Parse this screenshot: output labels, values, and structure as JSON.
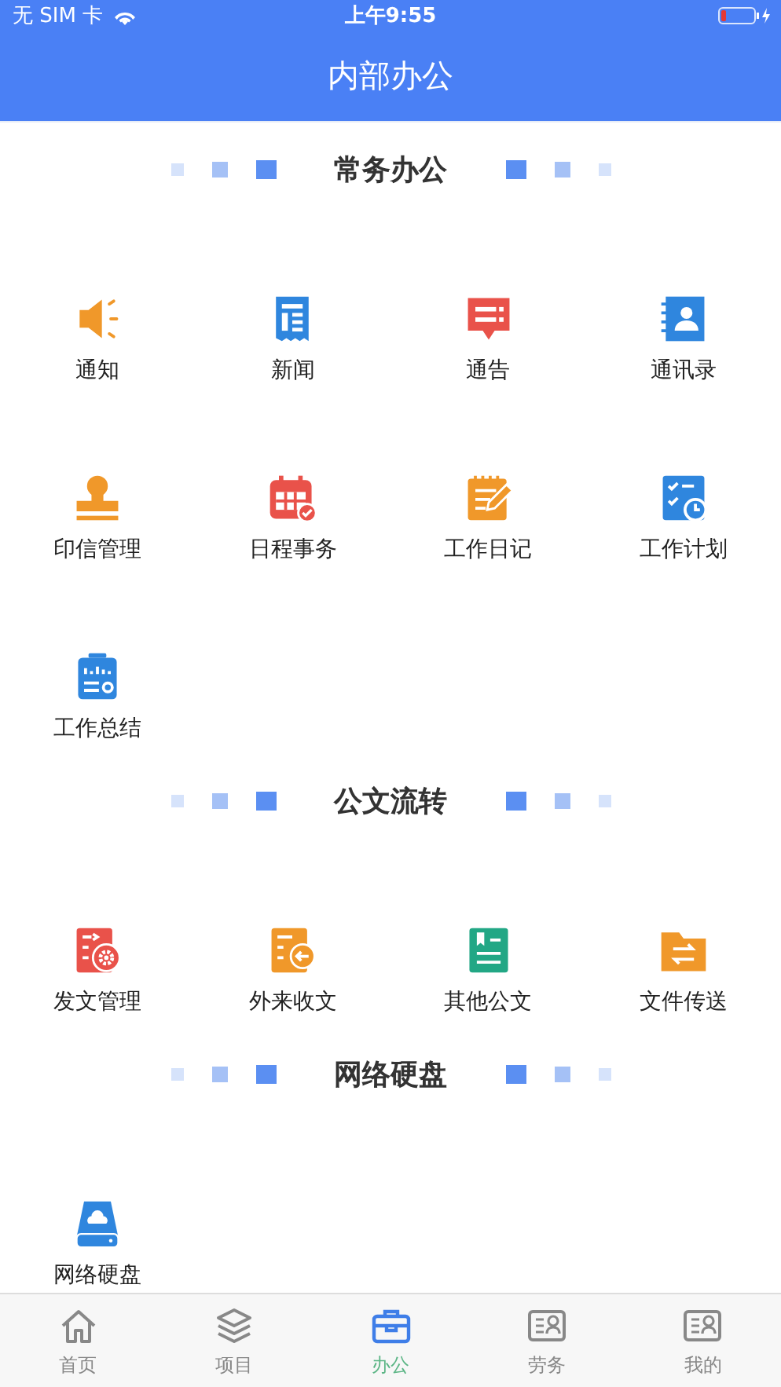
{
  "status_bar": {
    "carrier": "无 SIM 卡",
    "time": "上午9:55"
  },
  "nav_bar": {
    "title": "内部办公"
  },
  "sections": [
    {
      "title": "常务办公",
      "items": [
        {
          "label": "通知"
        },
        {
          "label": "新闻"
        },
        {
          "label": "通告"
        },
        {
          "label": "通讯录"
        },
        {
          "label": "印信管理"
        },
        {
          "label": "日程事务"
        },
        {
          "label": "工作日记"
        },
        {
          "label": "工作计划"
        },
        {
          "label": "工作总结"
        }
      ]
    },
    {
      "title": "公文流转",
      "items": [
        {
          "label": "发文管理"
        },
        {
          "label": "外来收文"
        },
        {
          "label": "其他公文"
        },
        {
          "label": "文件传送"
        }
      ]
    },
    {
      "title": "网络硬盘",
      "items": [
        {
          "label": "网络硬盘"
        }
      ]
    }
  ],
  "tabs": [
    {
      "label": "首页",
      "selected": false
    },
    {
      "label": "项目",
      "selected": false
    },
    {
      "label": "办公",
      "selected": true
    },
    {
      "label": "劳务",
      "selected": false
    },
    {
      "label": "我的",
      "selected": false
    }
  ]
}
